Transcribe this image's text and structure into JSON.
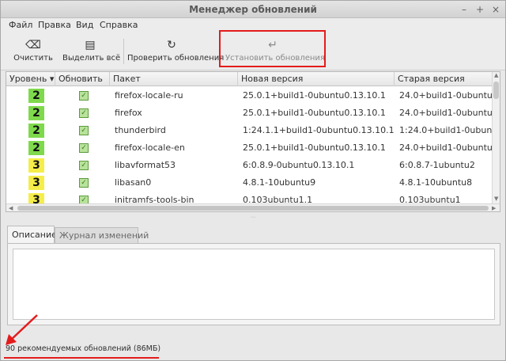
{
  "window": {
    "title": "Менеджер обновлений",
    "buttons": [
      "–",
      "+",
      "×"
    ]
  },
  "menubar": {
    "items": [
      "Файл",
      "Правка",
      "Вид",
      "Справка"
    ]
  },
  "toolbar": {
    "clear": {
      "label": "Очистить",
      "icon": "⌫"
    },
    "select_all": {
      "label": "Выделить всё",
      "icon": "▤"
    },
    "refresh": {
      "label": "Проверить обновления",
      "icon": "↻"
    },
    "install": {
      "label": "Установить обновления",
      "icon": "↵"
    }
  },
  "table": {
    "columns": {
      "level": "Уровень ▾",
      "update": "Обновить",
      "package": "Пакет",
      "new_version": "Новая версия",
      "old_version": "Старая версия"
    },
    "check_mark": "✓",
    "rows": [
      {
        "level": "2",
        "package": "firefox-locale-ru",
        "new_version": "25.0.1+build1-0ubuntu0.13.10.1",
        "old_version": "24.0+build1-0ubuntu1"
      },
      {
        "level": "2",
        "package": "firefox",
        "new_version": "25.0.1+build1-0ubuntu0.13.10.1",
        "old_version": "24.0+build1-0ubuntu1"
      },
      {
        "level": "2",
        "package": "thunderbird",
        "new_version": "1:24.1.1+build1-0ubuntu0.13.10.1",
        "old_version": "1:24.0+build1-0ubuntu1"
      },
      {
        "level": "2",
        "package": "firefox-locale-en",
        "new_version": "25.0.1+build1-0ubuntu0.13.10.1",
        "old_version": "24.0+build1-0ubuntu1"
      },
      {
        "level": "3",
        "package": "libavformat53",
        "new_version": "6:0.8.9-0ubuntu0.13.10.1",
        "old_version": "6:0.8.7-1ubuntu2"
      },
      {
        "level": "3",
        "package": "libasan0",
        "new_version": "4.8.1-10ubuntu9",
        "old_version": "4.8.1-10ubuntu8"
      },
      {
        "level": "3",
        "package": "initramfs-tools-bin",
        "new_version": "0.103ubuntu1.1",
        "old_version": "0.103ubuntu1"
      }
    ],
    "level_colors": {
      "2": "#7fd94c",
      "3": "#f5ee4a"
    }
  },
  "tabs": {
    "description": "Описание",
    "changelog": "Журнал изменений"
  },
  "status": {
    "text": "90 рекомендуемых обновлений (86МБ)"
  },
  "colors": {
    "annotation": "#e41b1b"
  }
}
